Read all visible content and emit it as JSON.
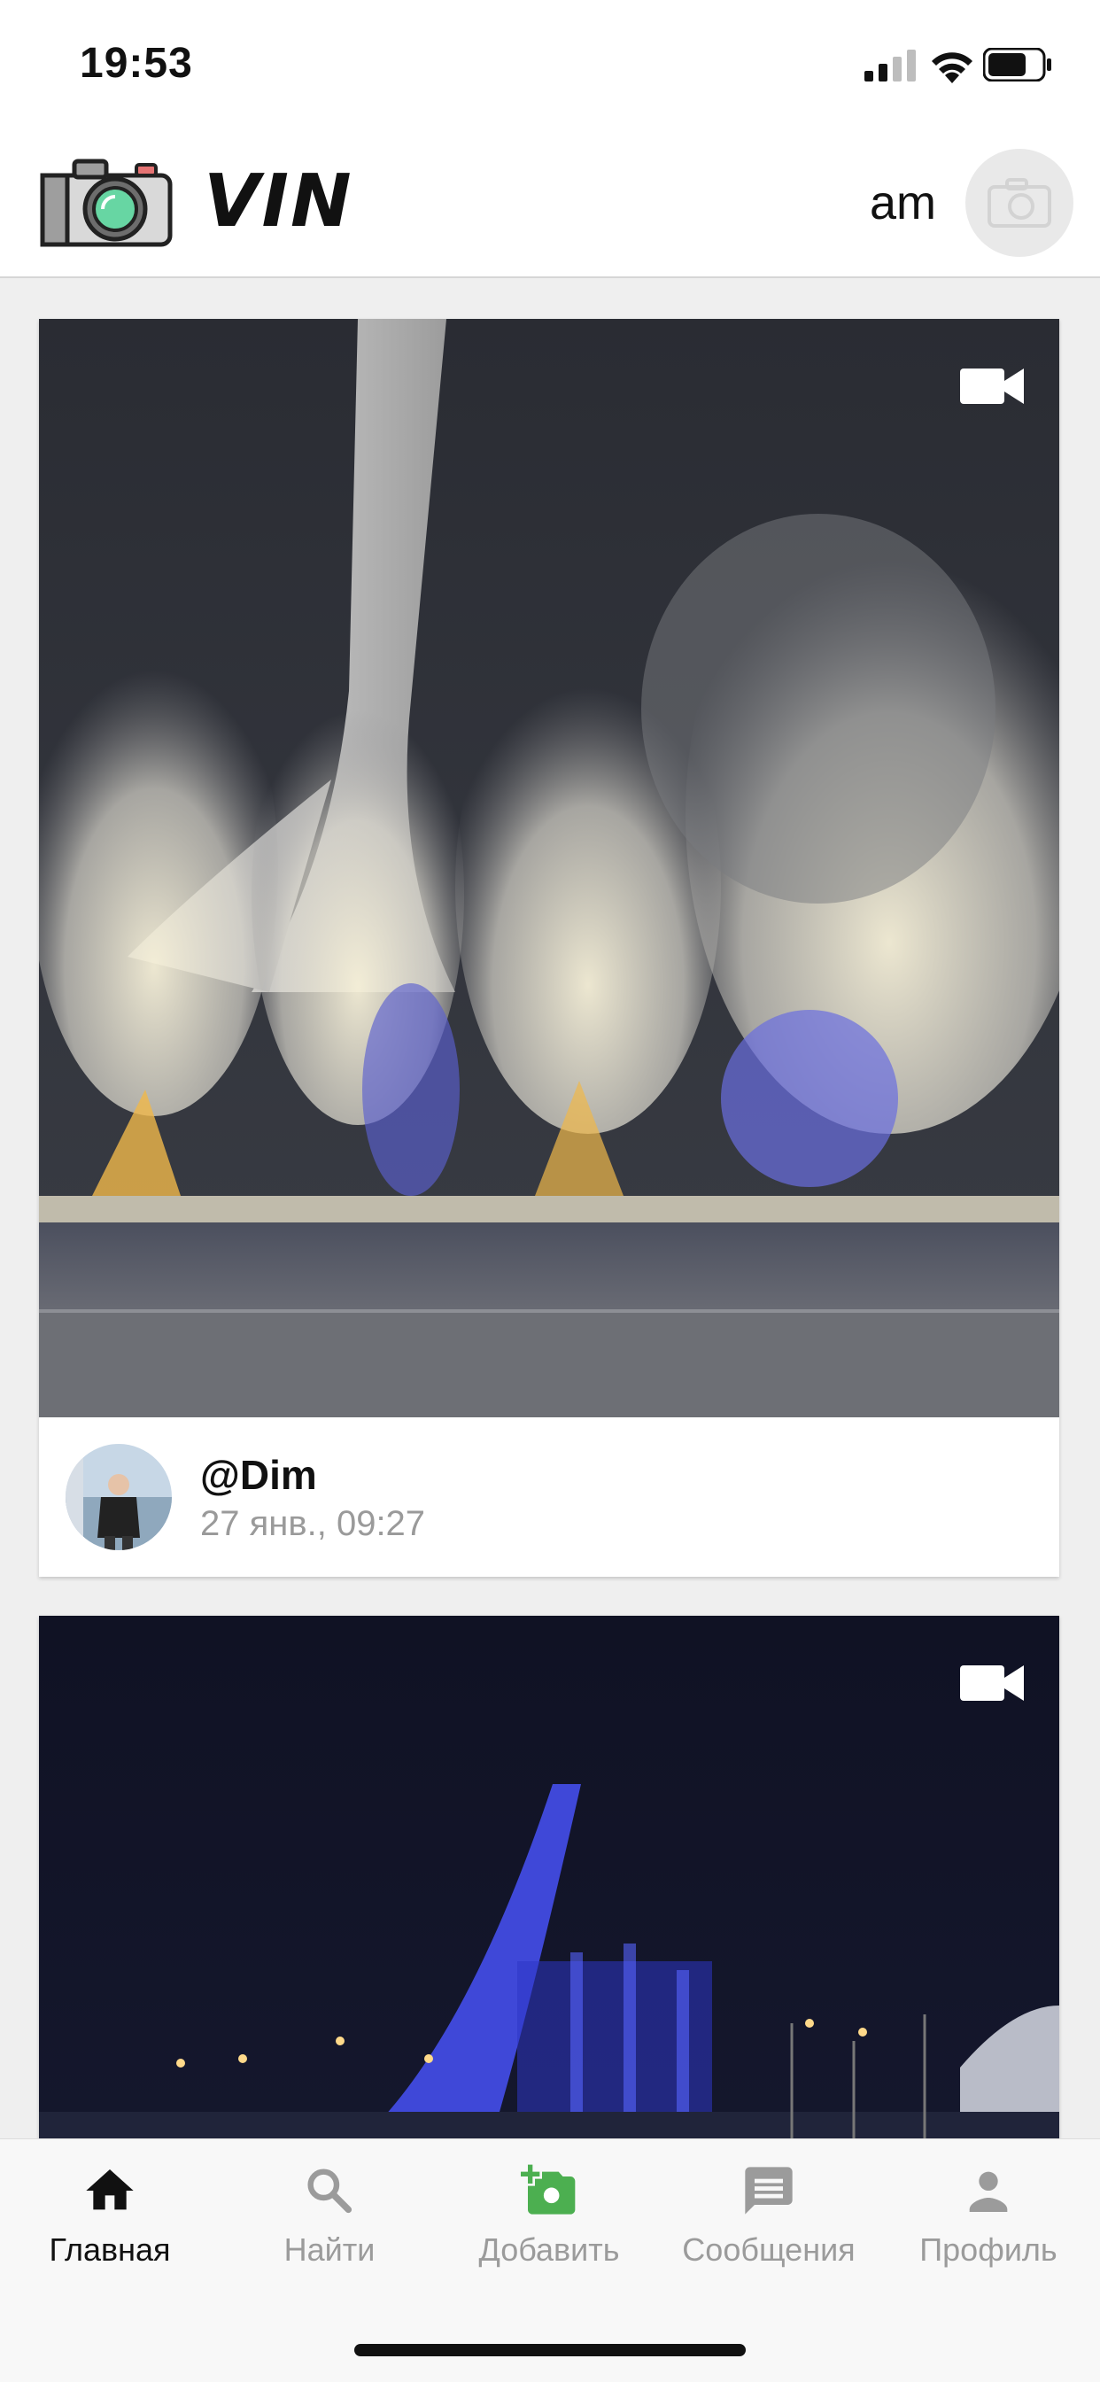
{
  "status_bar": {
    "time": "19:53"
  },
  "header": {
    "app_title": "VIN",
    "username": "am"
  },
  "feed": {
    "posts": [
      {
        "author": "@Dim",
        "date": "27 янв., 09:27",
        "media_type": "video"
      },
      {
        "media_type": "video"
      }
    ]
  },
  "bottom_nav": {
    "items": [
      {
        "label": "Главная",
        "icon": "home-icon",
        "active": true
      },
      {
        "label": "Найти",
        "icon": "search-icon"
      },
      {
        "label": "Добавить",
        "icon": "add-photo-icon"
      },
      {
        "label": "Сообщения",
        "icon": "message-icon"
      },
      {
        "label": "Профиль",
        "icon": "person-icon"
      }
    ]
  },
  "colors": {
    "accent_green": "#4caf50",
    "inactive_gray": "#9b9b9b",
    "active": "#111111"
  }
}
